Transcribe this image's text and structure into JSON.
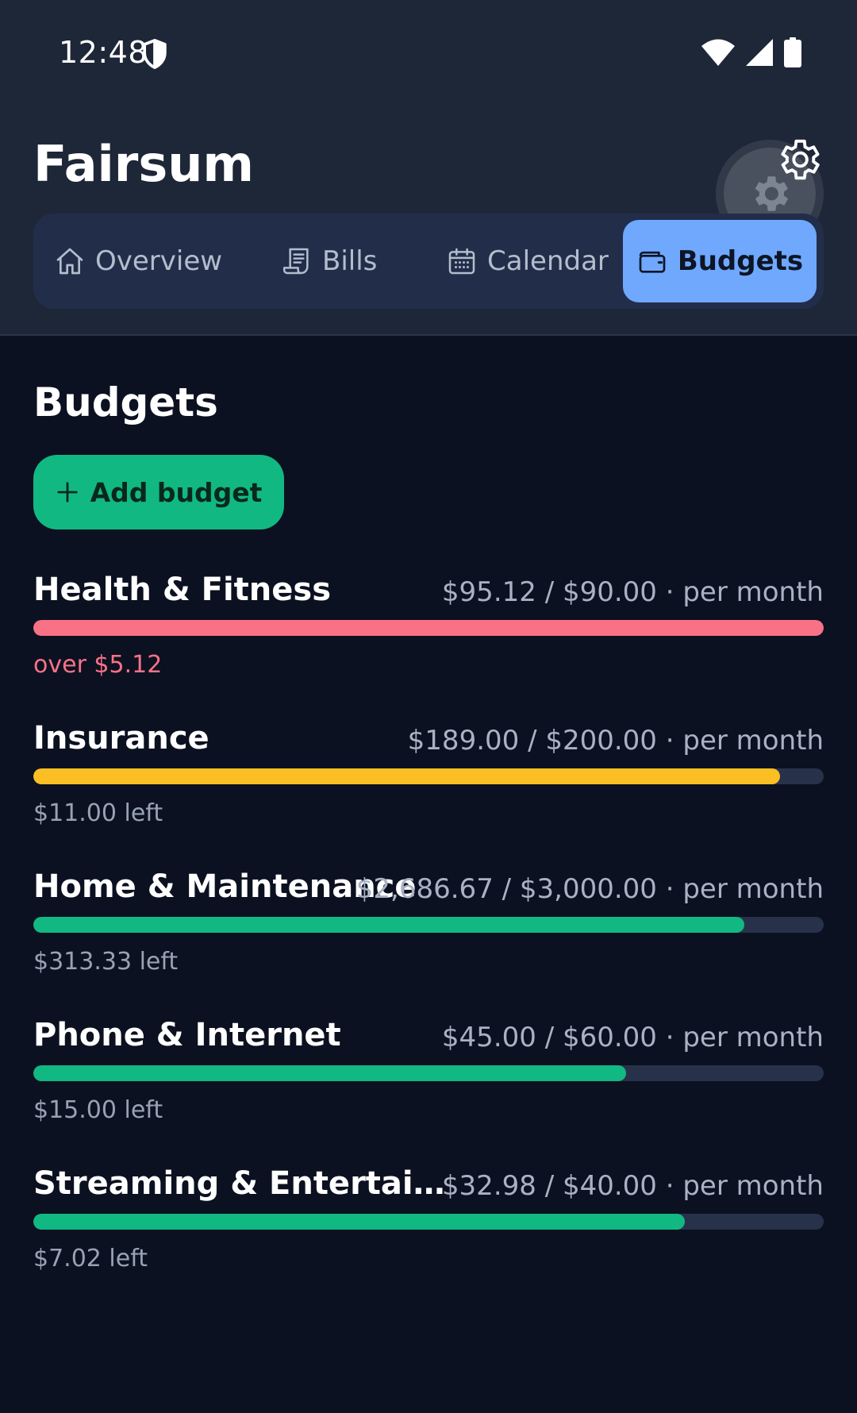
{
  "status_bar": {
    "time": "12:48"
  },
  "app": {
    "title": "Fairsum"
  },
  "tabs": [
    {
      "label": "Overview",
      "icon": "home-icon",
      "active": false
    },
    {
      "label": "Bills",
      "icon": "receipt-icon",
      "active": false
    },
    {
      "label": "Calendar",
      "icon": "calendar-icon",
      "active": false
    },
    {
      "label": "Budgets",
      "icon": "wallet-icon",
      "active": true
    }
  ],
  "section": {
    "title": "Budgets",
    "add_button_label": "Add budget"
  },
  "colors": {
    "over": "#f87187",
    "warning": "#fbbf24",
    "ok": "#12b882",
    "track": "#27324a",
    "active_tab": "#6fa8fd"
  },
  "budgets": [
    {
      "name": "Health & Fitness",
      "amount": "$95.12 / $90.00 · per month",
      "remaining": "over $5.12",
      "progress": 1.0,
      "status": "over"
    },
    {
      "name": "Insurance",
      "amount": "$189.00 / $200.00 · per month",
      "remaining": "$11.00 left",
      "progress": 0.945,
      "status": "warning"
    },
    {
      "name": "Home & Maintenance",
      "amount": "$2,686.67 / $3,000.00 · per month",
      "remaining": "$313.33 left",
      "progress": 0.9,
      "status": "ok"
    },
    {
      "name": "Phone & Internet",
      "amount": "$45.00 / $60.00 · per month",
      "remaining": "$15.00 left",
      "progress": 0.75,
      "status": "ok"
    },
    {
      "name": "Streaming & Entertainm...",
      "amount": "$32.98 / $40.00 · per month",
      "remaining": "$7.02 left",
      "progress": 0.8245,
      "status": "ok"
    }
  ]
}
